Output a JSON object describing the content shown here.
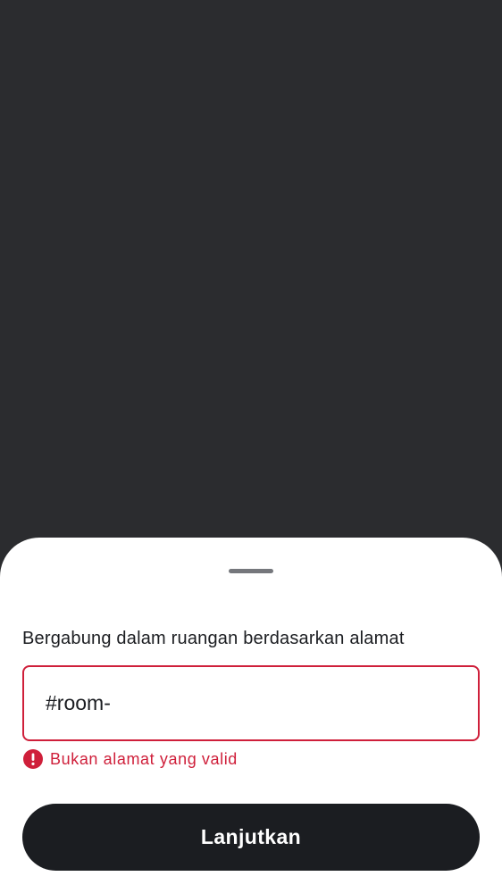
{
  "sheet": {
    "title": "Bergabung dalam ruangan berdasarkan alamat",
    "address_field": {
      "value": "#room-",
      "state": "error"
    },
    "error": {
      "icon": "error-icon",
      "message": "Bukan alamat yang valid"
    },
    "continue_label": "Lanjutkan"
  },
  "colors": {
    "scrim": "#2b2c2f",
    "sheet_background": "#ffffff",
    "text_primary": "#1b1d21",
    "error": "#cf1f3a",
    "button_background": "#1b1d21",
    "button_text": "#ffffff",
    "handle": "#75777c"
  }
}
